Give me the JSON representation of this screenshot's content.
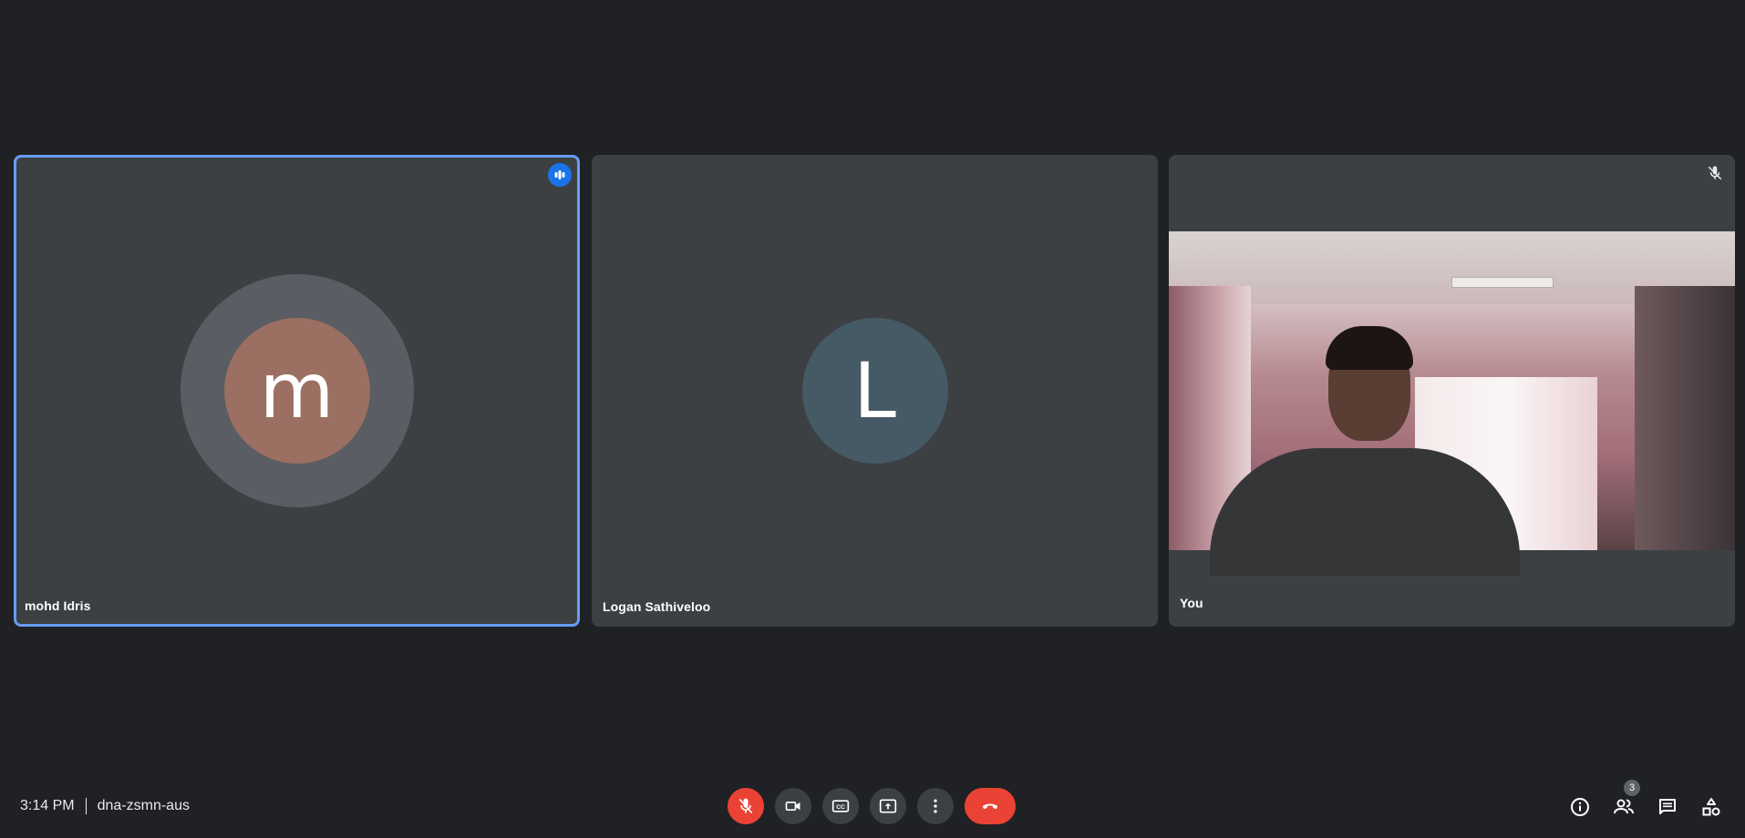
{
  "participants": [
    {
      "name": "mohd Idris",
      "initial": "m",
      "speaking": true
    },
    {
      "name": "Logan Sathiveloo",
      "initial": "L"
    },
    {
      "name": "You",
      "muted": true
    }
  ],
  "meeting": {
    "time": "3:14 PM",
    "code": "dna-zsmn-aus"
  },
  "people_count": "3",
  "colors": {
    "background": "#202124",
    "tile": "#3c4043",
    "accent": "#1a73e8",
    "danger": "#ea4335"
  }
}
